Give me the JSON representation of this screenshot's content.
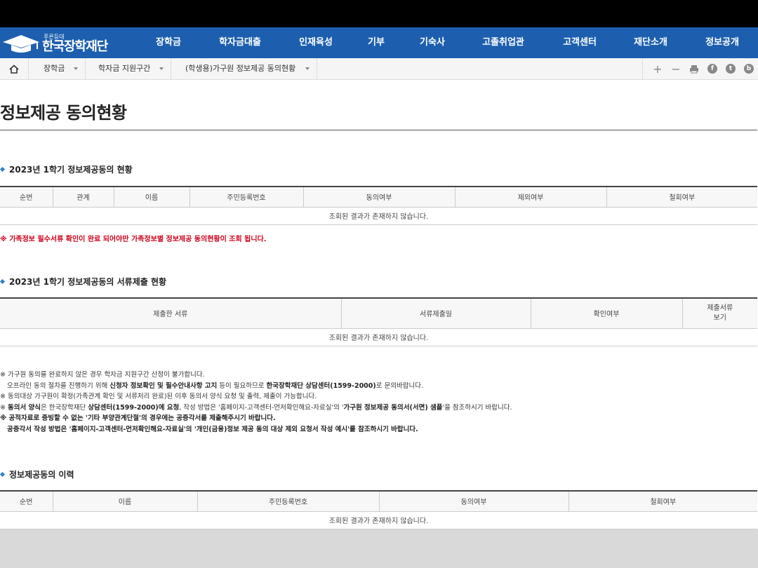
{
  "logo": {
    "sub": "푸른등대",
    "main": "한국장학재단"
  },
  "nav": [
    "장학금",
    "학자금대출",
    "인재육성",
    "기부",
    "기숙사",
    "고졸취업관",
    "고객센터",
    "재단소개",
    "정보공개"
  ],
  "breadcrumb": [
    "장학금",
    "학자금 지원구간",
    "(학생용)가구원 정보제공 동의현황"
  ],
  "page_title": "정보제공 동의현황",
  "section1": {
    "title": "2023년 1학기 정보제공동의 현황",
    "columns": [
      "순번",
      "관계",
      "이름",
      "주민등록번호",
      "동의여부",
      "제외여부",
      "철회여부"
    ],
    "empty": "조회된 결과가 존재하지 않습니다."
  },
  "red_note": "※ 가족정보 필수서류 확인이 완료 되어야만 가족정보별 정보제공 동의현황이 조회 됩니다.",
  "section2": {
    "title": "2023년 1학기 정보제공동의 서류제출 현황",
    "columns": [
      "제출한 서류",
      "서류제출일",
      "확인여부",
      "제출서류\n보기"
    ],
    "empty": "조회된 결과가 존재하지 않습니다."
  },
  "notes": {
    "n1": "※ 가구원 동의를 완료하지 않은 경우 학자금 지원구간 산정이 불가합니다.",
    "n2a": "오프라인 동의 절차를 진행하기 위해 ",
    "n2b": "신청자 정보확인 및 필수안내사항 고지",
    "n2c": " 등이 필요하므로 ",
    "n2d": "한국장학재단 상담센터(1599-2000)",
    "n2e": "로 문의바랍니다.",
    "n3": "※ 동의대상 가구원이 확정(가족관계 확인 및 서류처리 완료)된 이후 동의서 양식 요청 및 출력, 제출이 가능합니다.",
    "n4a": "※ ",
    "n4b": "동의서 양식",
    "n4c": "은 한국장학재단 ",
    "n4d": "상담센터(1599-2000)에 요청",
    "n4e": ", 작성 방법은 '홈페이지-고객센터-먼저확인해요-자료실'의 '",
    "n4f": "가구원 정보제공 동의서(서면) 샘플",
    "n4g": "'을 참조하시기 바랍니다.",
    "n5": "※ 공적자료로 증빙할 수 없는 '기타 부양관계단절'의 경우에는 공증각서를 제출해주시기 바랍니다.",
    "n6": "공증각서 작성 방법은 '홈페이지-고객센터-먼저확인해요-자료실'의 '개인(금융)정보 제공 동의 대상 제외 요청서 작성 예시'를 참조하시기 바랍니다."
  },
  "section3": {
    "title": "정보제공동의 이력",
    "columns": [
      "순번",
      "이름",
      "주민등록번호",
      "동의여부",
      "철회여부"
    ],
    "empty": "조회된 결과가 존재하지 않습니다."
  }
}
